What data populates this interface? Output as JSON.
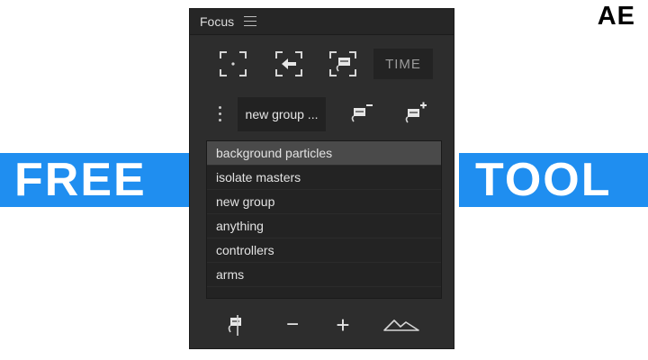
{
  "corner_tag": "AE",
  "banner": {
    "left": "FREE",
    "right": "TOOL",
    "color": "#1f8ef0"
  },
  "panel": {
    "title": "Focus",
    "toolbar": {
      "time_label": "TIME"
    },
    "group_selector": {
      "value": "new group ..."
    },
    "groups": [
      {
        "label": "background particles",
        "selected": true
      },
      {
        "label": "isolate masters",
        "selected": false
      },
      {
        "label": "new group",
        "selected": false
      },
      {
        "label": "anything",
        "selected": false
      },
      {
        "label": "controllers",
        "selected": false
      },
      {
        "label": "arms",
        "selected": false
      }
    ],
    "footer": {
      "minus_label": "−",
      "plus_label": "+"
    }
  }
}
